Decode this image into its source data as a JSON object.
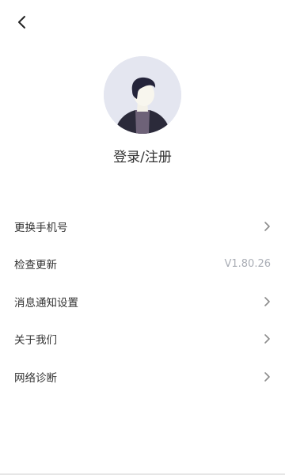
{
  "header": {
    "back_icon": "chevron-left-icon"
  },
  "profile": {
    "avatar_icon": "default-user-avatar",
    "login_label": "登录/注册"
  },
  "menu": {
    "items": [
      {
        "label": "更换手机号",
        "right_icon": "chevron-right-icon"
      },
      {
        "label": "检查更新",
        "value": "V1.80.26"
      },
      {
        "label": "消息通知设置",
        "right_icon": "chevron-right-icon"
      },
      {
        "label": "关于我们",
        "right_icon": "chevron-right-icon"
      },
      {
        "label": "网络诊断",
        "right_icon": "chevron-right-icon"
      }
    ]
  },
  "colors": {
    "text": "#333333",
    "muted": "#a9adb5",
    "chevron": "#8c8c8c",
    "avatar_bg": "#e4e6f0"
  }
}
